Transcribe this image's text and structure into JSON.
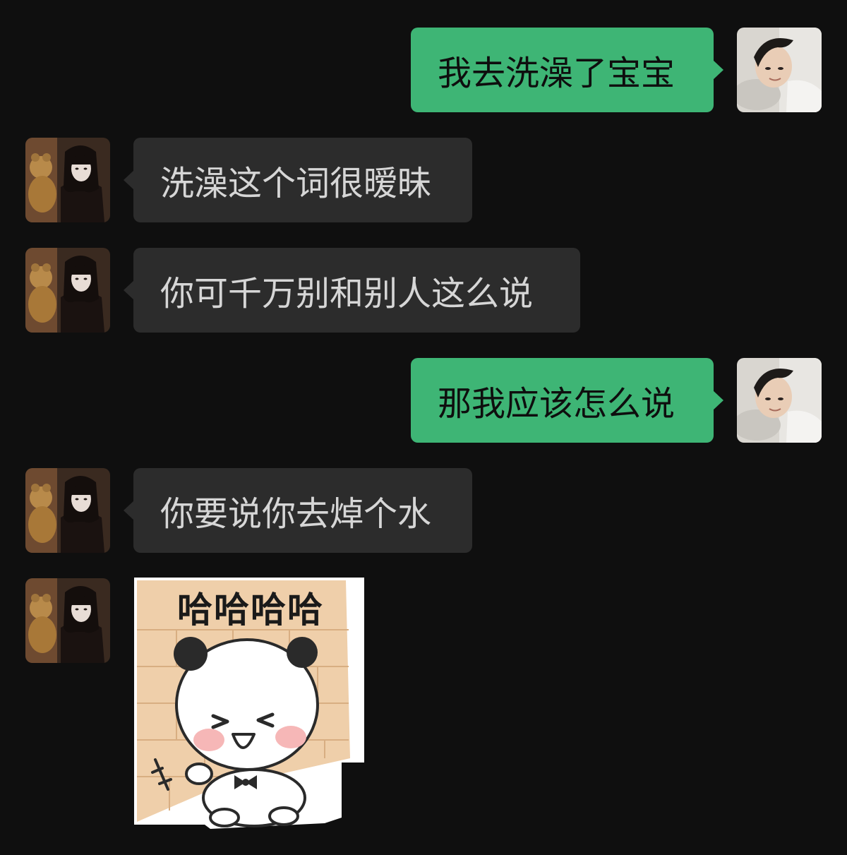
{
  "chat": {
    "messages": [
      {
        "sender": "me",
        "text": "我去洗澡了宝宝"
      },
      {
        "sender": "them",
        "text": "洗澡这个词很暧昧"
      },
      {
        "sender": "them",
        "text": "你可千万别和别人这么说"
      },
      {
        "sender": "me",
        "text": "那我应该怎么说"
      },
      {
        "sender": "them",
        "text": "你要说你去焯个水"
      },
      {
        "sender": "them",
        "sticker_caption": "哈哈哈哈"
      }
    ]
  },
  "colors": {
    "background": "#0f0f0f",
    "outgoing_bubble": "#3eb575",
    "incoming_bubble": "#2c2c2c",
    "incoming_text": "#d6d6d6"
  },
  "icons": {
    "my_avatar": "boy-avatar-photo",
    "their_avatar": "girl-avatar-photo",
    "sticker": "panda-laughing-sticker"
  }
}
